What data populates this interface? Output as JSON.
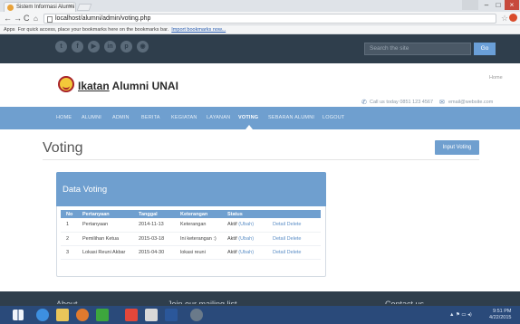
{
  "browser": {
    "tab_title": "Sistem Informasi Alumni",
    "tab_close": "×",
    "url": "localhost/alumni/admin/voting.php",
    "bookmarks_apps": "Apps",
    "bookmarks_text": "For quick access, place your bookmarks here on the bookmarks bar.",
    "bookmarks_link": "Import bookmarks now...",
    "min": "–",
    "max": "□",
    "close": "×"
  },
  "site": {
    "search_placeholder": "Search the site",
    "go": "Go",
    "brand_u": "Ikatan",
    "brand_rest": " Alumni UNAI",
    "home_crumb": "Home",
    "phone": "Call us today 0851 123 4567",
    "email": "email@website.com"
  },
  "nav": {
    "items": [
      "HOME",
      "ALUMNI",
      "ADMIN",
      "BERITA",
      "KEGIATAN",
      "LAYANAN",
      "VOTING",
      "SEBARAN ALUMNI",
      "LOGOUT"
    ],
    "active": "VOTING"
  },
  "main": {
    "title": "Voting",
    "input_button": "Input Voting",
    "panel_title": "Data Voting",
    "columns": [
      "No",
      "Pertanyaan",
      "Tanggal",
      "Keterangan",
      "Status",
      ""
    ],
    "rows": [
      {
        "no": "1",
        "q": "Pertanyaan",
        "date": "2014-11-13",
        "ket": "Keterangan",
        "status": "Aktif",
        "ubah": "(Ubah)",
        "detail": "Detail",
        "delete": "Delete"
      },
      {
        "no": "2",
        "q": "Pemilihan Ketua",
        "date": "2015-03-18",
        "ket": "Ini keterangan :)",
        "status": "Aktif",
        "ubah": "(Ubah)",
        "detail": "Detail",
        "delete": "Delete"
      },
      {
        "no": "3",
        "q": "Lokasi Reuni Akbar",
        "date": "2015-04-30",
        "ket": "lokasi reuni",
        "status": "Aktif",
        "ubah": "(Ubah)",
        "detail": "Detail",
        "delete": "Delete"
      }
    ]
  },
  "footer": {
    "about": "About",
    "mailing": "Join our mailing list",
    "contact": "Contact us"
  },
  "taskbar": {
    "time": "9:51 PM",
    "date": "4/22/2015"
  },
  "colors": {
    "accent": "#6f9fcf",
    "dark": "#2f3e4c"
  }
}
